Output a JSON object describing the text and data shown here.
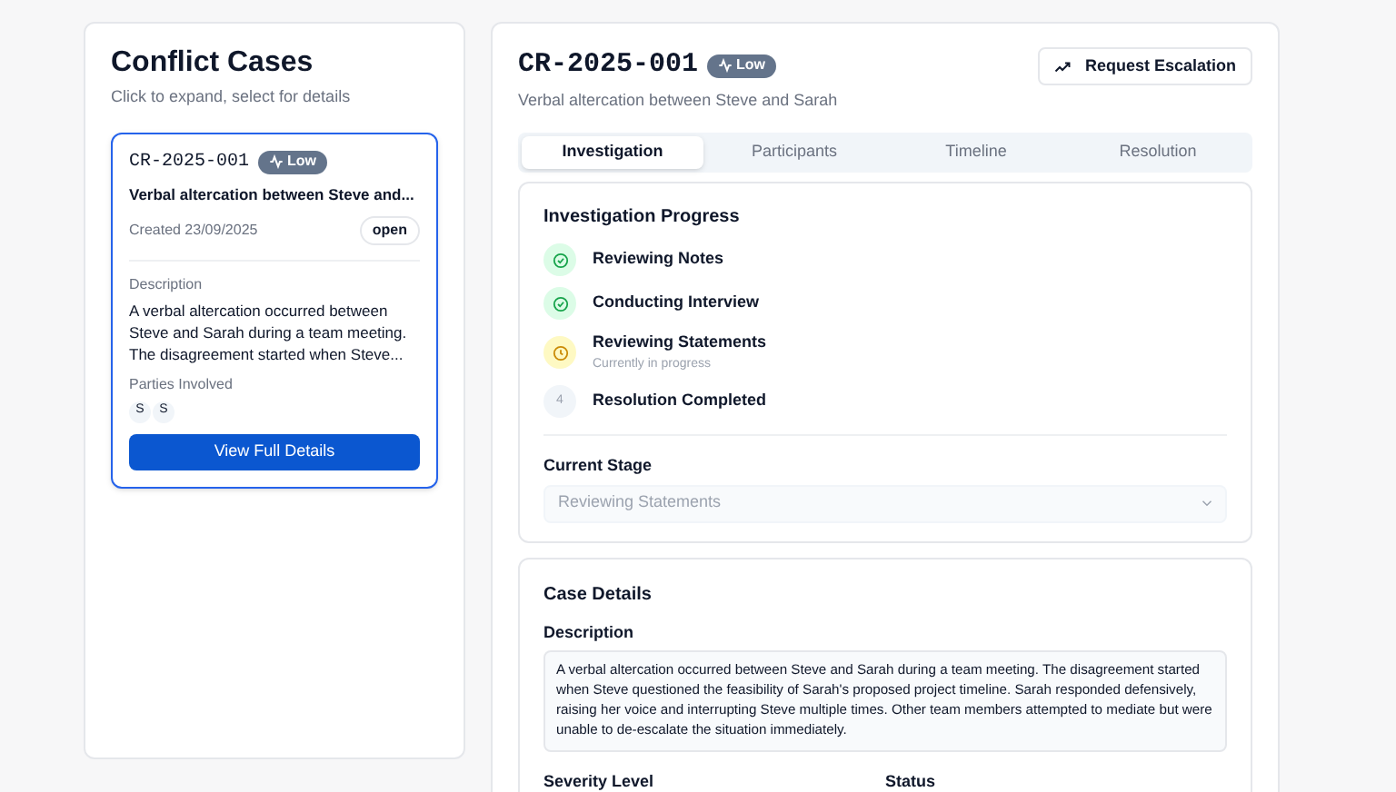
{
  "sidebar": {
    "title": "Conflict Cases",
    "subtitle": "Click to expand, select for details",
    "cases": [
      {
        "id": "CR-2025-001",
        "severity": "Low",
        "title": "Verbal altercation between Steve and...",
        "created": "Created 23/09/2025",
        "status": "open",
        "selected": true,
        "description_label": "Description",
        "description": "A verbal altercation occurred between Steve and Sarah during a team meeting. The disagreement started when Steve...",
        "parties_label": "Parties Involved",
        "parties": [
          "S",
          "S"
        ],
        "button": "View Full Details"
      }
    ]
  },
  "detail": {
    "id": "CR-2025-001",
    "severity": "Low",
    "subtitle": "Verbal altercation between Steve and Sarah",
    "escalate_button": "Request Escalation",
    "tabs": [
      {
        "label": "Investigation",
        "selected": true
      },
      {
        "label": "Participants",
        "selected": false
      },
      {
        "label": "Timeline",
        "selected": false
      },
      {
        "label": "Resolution",
        "selected": false
      }
    ],
    "progress": {
      "title": "Investigation Progress",
      "steps": [
        {
          "label": "Reviewing Notes",
          "kind": "done"
        },
        {
          "label": "Conducting Interview",
          "kind": "done"
        },
        {
          "label": "Reviewing Statements",
          "kind": "current",
          "note": "Currently in progress"
        },
        {
          "label": "Resolution Completed",
          "kind": "pending",
          "number": "4"
        }
      ],
      "stage_label": "Current Stage",
      "stage_value": "Reviewing Statements"
    },
    "case_details": {
      "title": "Case Details",
      "description_label": "Description",
      "description": "A verbal altercation occurred between Steve and Sarah during a team meeting. The disagreement started when Steve questioned the feasibility of Sarah's proposed project timeline. Sarah responded defensively, raising her voice and interrupting Steve multiple times. Other team members attempted to mediate but were unable to de-escalate the situation immediately.",
      "severity_label": "Severity Level",
      "status_label": "Status"
    }
  }
}
